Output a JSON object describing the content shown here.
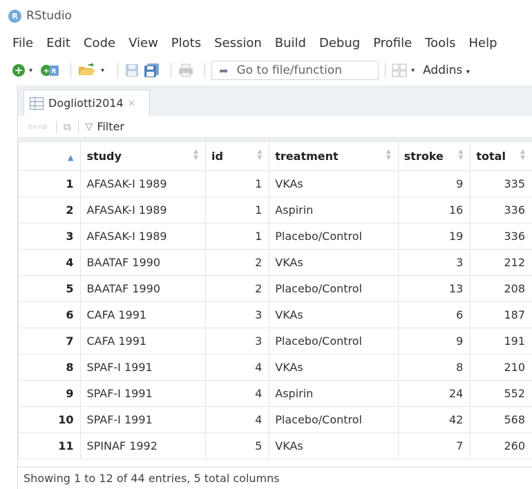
{
  "app": {
    "title": "RStudio",
    "logo_letter": "R"
  },
  "menu": [
    "File",
    "Edit",
    "Code",
    "View",
    "Plots",
    "Session",
    "Build",
    "Debug",
    "Profile",
    "Tools",
    "Help"
  ],
  "toolbar": {
    "goto_placeholder": "Go to file/function",
    "addins_label": "Addins"
  },
  "tab": {
    "label": "Dogliotti2014",
    "close": "×"
  },
  "viewer": {
    "filter_label": "Filter"
  },
  "table": {
    "columns": [
      "study",
      "id",
      "treatment",
      "stroke",
      "total"
    ],
    "rows": [
      {
        "n": "1",
        "study": "AFASAK-I 1989",
        "id": "1",
        "treatment": "VKAs",
        "stroke": "9",
        "total": "335"
      },
      {
        "n": "2",
        "study": "AFASAK-I 1989",
        "id": "1",
        "treatment": "Aspirin",
        "stroke": "16",
        "total": "336"
      },
      {
        "n": "3",
        "study": "AFASAK-I 1989",
        "id": "1",
        "treatment": "Placebo/Control",
        "stroke": "19",
        "total": "336"
      },
      {
        "n": "4",
        "study": "BAATAF 1990",
        "id": "2",
        "treatment": "VKAs",
        "stroke": "3",
        "total": "212"
      },
      {
        "n": "5",
        "study": "BAATAF 1990",
        "id": "2",
        "treatment": "Placebo/Control",
        "stroke": "13",
        "total": "208"
      },
      {
        "n": "6",
        "study": "CAFA 1991",
        "id": "3",
        "treatment": "VKAs",
        "stroke": "6",
        "total": "187"
      },
      {
        "n": "7",
        "study": "CAFA 1991",
        "id": "3",
        "treatment": "Placebo/Control",
        "stroke": "9",
        "total": "191"
      },
      {
        "n": "8",
        "study": "SPAF-I 1991",
        "id": "4",
        "treatment": "VKAs",
        "stroke": "8",
        "total": "210"
      },
      {
        "n": "9",
        "study": "SPAF-I 1991",
        "id": "4",
        "treatment": "Aspirin",
        "stroke": "24",
        "total": "552"
      },
      {
        "n": "10",
        "study": "SPAF-I 1991",
        "id": "4",
        "treatment": "Placebo/Control",
        "stroke": "42",
        "total": "568"
      },
      {
        "n": "11",
        "study": "SPINAF 1992",
        "id": "5",
        "treatment": "VKAs",
        "stroke": "7",
        "total": "260"
      }
    ]
  },
  "footer": {
    "status": "Showing 1 to 12 of 44 entries, 5 total columns"
  },
  "colors": {
    "plus_green": "#3c9a3a",
    "logo_blue": "#75aadb",
    "sort_active": "#5b8ed4"
  }
}
